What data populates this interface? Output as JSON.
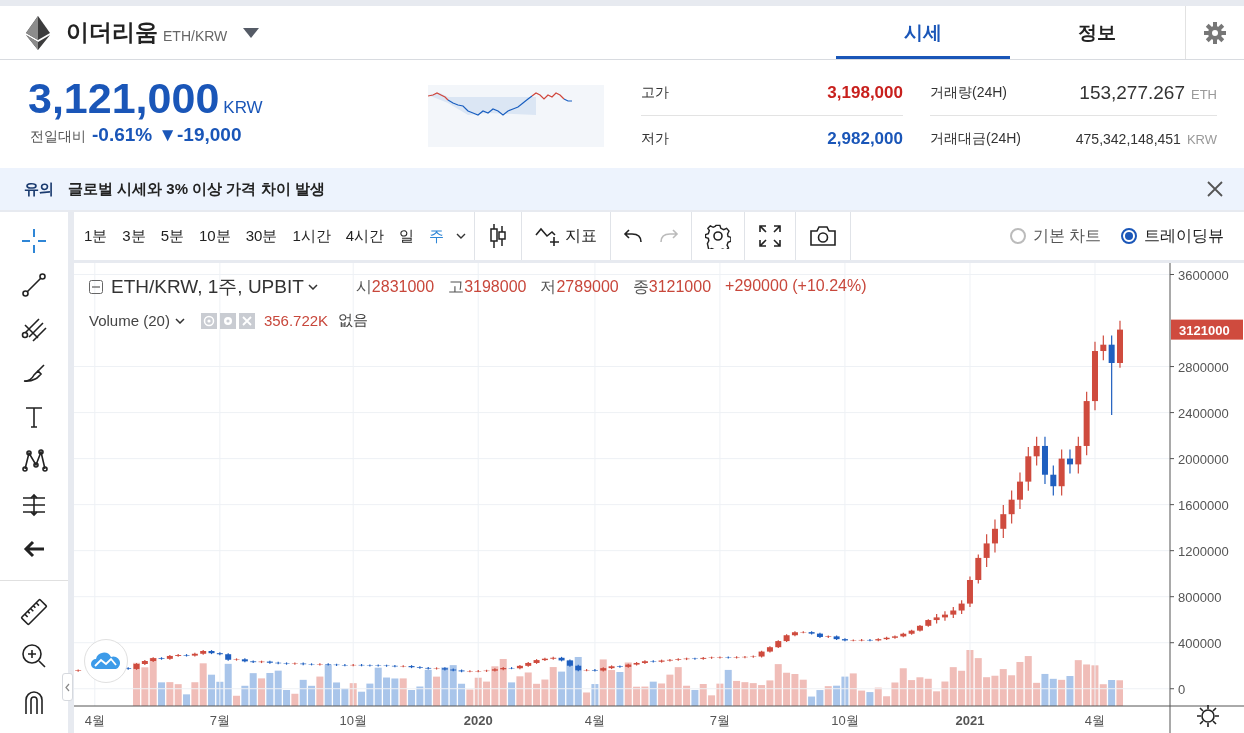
{
  "header": {
    "coin_name": "이더리움",
    "pair": "ETH/KRW"
  },
  "tabs": [
    {
      "label": "시세",
      "selected": true
    },
    {
      "label": "정보",
      "selected": false
    }
  ],
  "price": {
    "value": "3,121,000",
    "unit": "KRW",
    "change_label": "전일대비",
    "change_rate": "-0.61%",
    "change_amount": "▼-19,000",
    "color": "#1a56b8"
  },
  "stats": [
    {
      "label": "고가",
      "value": "3,198,000",
      "color": "#c8201d"
    },
    {
      "label": "저가",
      "value": "2,982,000",
      "color": "#1a56b8"
    }
  ],
  "volume_stats": [
    {
      "label": "거래량(24H)",
      "value": "153,277.267",
      "unit": "ETH",
      "kind": "large"
    },
    {
      "label": "거래대금(24H)",
      "value": "475,342,148,451",
      "unit": "KRW",
      "kind": "small"
    }
  ],
  "notice": {
    "tag": "유의",
    "message": "글로벌 시세와 3% 이상 가격 차이 발생"
  },
  "intervals": [
    {
      "label": "1분",
      "selected": false
    },
    {
      "label": "3분",
      "selected": false
    },
    {
      "label": "5분",
      "selected": false
    },
    {
      "label": "10분",
      "selected": false
    },
    {
      "label": "30분",
      "selected": false
    },
    {
      "label": "1시간",
      "selected": false
    },
    {
      "label": "4시간",
      "selected": false
    },
    {
      "label": "일",
      "selected": false
    },
    {
      "label": "주",
      "selected": true
    }
  ],
  "indicator_label": "지표",
  "chart_modes": [
    {
      "label": "기본 차트",
      "selected": false
    },
    {
      "label": "트레이딩뷰",
      "selected": true
    }
  ],
  "legend": {
    "symbol": "ETH/KRW, 1주, UPBIT",
    "ohlc": [
      {
        "label": "시",
        "value": "2831000"
      },
      {
        "label": "고",
        "value": "3198000"
      },
      {
        "label": "저",
        "value": "2789000"
      },
      {
        "label": "종",
        "value": "3121000"
      }
    ],
    "change": "+290000 (+10.24%)"
  },
  "volume_legend": {
    "name": "Volume (20)",
    "value": "356.722K",
    "extra": "없음"
  },
  "chart": {
    "price_tag": "3121000",
    "tick_styles": [
      {
        "bold": false
      },
      {
        "bold": false
      },
      {
        "bold": false
      },
      {
        "bold": true
      },
      {
        "bold": false
      },
      {
        "bold": false
      },
      {
        "bold": false
      },
      {
        "bold": true
      },
      {
        "bold": false
      }
    ],
    "chart_data": {
      "type": "candlestick",
      "grid": true,
      "ylim": [
        -150000,
        3700000
      ],
      "categories": [
        null,
        null,
        "4월",
        null,
        null,
        null,
        null,
        null,
        null,
        null,
        null,
        null,
        null,
        null,
        null,
        null,
        null,
        "7월",
        null,
        null,
        null,
        null,
        null,
        null,
        null,
        null,
        null,
        null,
        null,
        null,
        null,
        null,
        null,
        "10월",
        null,
        null,
        null,
        null,
        null,
        null,
        null,
        null,
        null,
        null,
        null,
        null,
        null,
        null,
        "2020",
        null,
        null,
        null,
        null,
        null,
        null,
        null,
        null,
        null,
        null,
        null,
        null,
        null,
        "4월",
        null,
        null,
        null,
        null,
        null,
        null,
        null,
        null,
        null,
        null,
        null,
        null,
        null,
        null,
        "7월",
        null,
        null,
        null,
        null,
        null,
        null,
        null,
        null,
        null,
        null,
        null,
        null,
        null,
        null,
        "10월",
        null,
        null,
        null,
        null,
        null,
        null,
        null,
        null,
        null,
        null,
        null,
        null,
        null,
        null,
        "2021",
        null,
        null,
        null,
        null,
        null,
        null,
        null,
        null,
        null,
        null,
        null,
        null,
        null,
        null,
        "4월",
        null,
        null,
        null
      ],
      "yticks": [
        {
          "value": 3600000,
          "label": "3600000"
        },
        {
          "value": 2800000,
          "label": "2800000"
        },
        {
          "value": 2400000,
          "label": "2400000"
        },
        {
          "value": 2000000,
          "label": "2000000"
        },
        {
          "value": 1600000,
          "label": "1600000"
        },
        {
          "value": 1200000,
          "label": "1200000"
        },
        {
          "value": 800000,
          "label": "800000"
        },
        {
          "value": 400000,
          "label": "400000"
        },
        {
          "value": 0,
          "label": "0"
        }
      ],
      "ohlc": [
        [
          155000,
          168000,
          147000,
          160000
        ],
        null,
        null,
        null,
        null,
        null,
        [
          178000,
          186000,
          164000,
          172000
        ],
        [
          172000,
          223000,
          164000,
          215000
        ],
        [
          215000,
          249000,
          207000,
          241000
        ],
        [
          241000,
          274000,
          233000,
          266000
        ],
        [
          266000,
          274000,
          252000,
          260000
        ],
        [
          260000,
          293000,
          252000,
          285000
        ],
        [
          285000,
          301000,
          277000,
          293000
        ],
        [
          293000,
          301000,
          280000,
          288000
        ],
        [
          288000,
          312000,
          280000,
          304000
        ],
        [
          304000,
          336000,
          296000,
          328000
        ],
        [
          328000,
          336000,
          301000,
          309000
        ],
        [
          309000,
          317000,
          292000,
          300000
        ],
        [
          300000,
          308000,
          244000,
          252000
        ],
        [
          252000,
          264000,
          244000,
          256000
        ],
        [
          256000,
          264000,
          230000,
          238000
        ],
        [
          238000,
          246000,
          223000,
          231000
        ],
        [
          231000,
          244000,
          223000,
          236000
        ],
        [
          236000,
          244000,
          218000,
          226000
        ],
        [
          226000,
          234000,
          213000,
          221000
        ],
        [
          221000,
          229000,
          209000,
          217000
        ],
        [
          217000,
          227000,
          209000,
          219000
        ],
        [
          219000,
          227000,
          205000,
          213000
        ],
        [
          213000,
          221000,
          203000,
          211000
        ],
        [
          211000,
          222000,
          203000,
          214000
        ],
        [
          214000,
          222000,
          201000,
          209000
        ],
        [
          209000,
          217000,
          198000,
          206000
        ],
        [
          206000,
          214000,
          196000,
          204000
        ],
        [
          204000,
          215000,
          196000,
          207000
        ],
        [
          207000,
          215000,
          195000,
          203000
        ],
        [
          203000,
          211000,
          194000,
          202000
        ],
        [
          202000,
          210000,
          193000,
          201000
        ],
        [
          201000,
          209000,
          191000,
          199000
        ],
        [
          199000,
          207000,
          186000,
          194000
        ],
        [
          194000,
          205000,
          186000,
          197000
        ],
        [
          197000,
          205000,
          179000,
          187000
        ],
        [
          187000,
          195000,
          173000,
          181000
        ],
        [
          181000,
          189000,
          167000,
          175000
        ],
        [
          175000,
          186000,
          167000,
          178000
        ],
        [
          178000,
          186000,
          159000,
          167000
        ],
        [
          167000,
          175000,
          151000,
          159000
        ],
        [
          159000,
          167000,
          143000,
          151000
        ],
        [
          151000,
          160000,
          143000,
          152000
        ],
        [
          152000,
          162000,
          144000,
          154000
        ],
        [
          154000,
          165000,
          146000,
          157000
        ],
        [
          157000,
          177000,
          149000,
          169000
        ],
        [
          169000,
          188000,
          161000,
          180000
        ],
        [
          180000,
          188000,
          170000,
          178000
        ],
        [
          178000,
          207000,
          170000,
          199000
        ],
        [
          199000,
          232000,
          191000,
          224000
        ],
        [
          224000,
          257000,
          216000,
          249000
        ],
        [
          249000,
          269000,
          241000,
          261000
        ],
        [
          261000,
          277000,
          253000,
          269000
        ],
        [
          269000,
          277000,
          238000,
          246000
        ],
        [
          246000,
          254000,
          192000,
          200000
        ],
        [
          200000,
          208000,
          152000,
          160000
        ],
        [
          160000,
          171000,
          152000,
          163000
        ],
        [
          163000,
          171000,
          150000,
          158000
        ],
        [
          158000,
          187000,
          150000,
          179000
        ],
        [
          179000,
          203000,
          171000,
          195000
        ],
        [
          195000,
          203000,
          182000,
          190000
        ],
        [
          190000,
          218000,
          182000,
          210000
        ],
        [
          210000,
          232000,
          202000,
          224000
        ],
        [
          224000,
          247000,
          216000,
          239000
        ],
        [
          239000,
          247000,
          227000,
          235000
        ],
        [
          235000,
          253000,
          227000,
          245000
        ],
        [
          245000,
          259000,
          237000,
          251000
        ],
        [
          251000,
          265000,
          243000,
          257000
        ],
        [
          257000,
          270000,
          249000,
          262000
        ],
        [
          262000,
          270000,
          252000,
          260000
        ],
        [
          260000,
          276000,
          252000,
          268000
        ],
        [
          268000,
          279000,
          260000,
          271000
        ],
        [
          271000,
          280000,
          263000,
          272000
        ],
        [
          272000,
          280000,
          262000,
          270000
        ],
        [
          270000,
          282000,
          262000,
          274000
        ],
        [
          274000,
          285000,
          266000,
          277000
        ],
        [
          277000,
          288000,
          269000,
          280000
        ],
        [
          280000,
          331000,
          272000,
          323000
        ],
        [
          323000,
          369000,
          315000,
          361000
        ],
        [
          361000,
          422000,
          353000,
          414000
        ],
        [
          414000,
          473000,
          406000,
          465000
        ],
        [
          465000,
          499000,
          457000,
          491000
        ],
        [
          491000,
          500000,
          483000,
          492000
        ],
        [
          492000,
          500000,
          471000,
          479000
        ],
        [
          479000,
          487000,
          442000,
          450000
        ],
        [
          450000,
          463000,
          442000,
          455000
        ],
        [
          455000,
          463000,
          423000,
          431000
        ],
        [
          431000,
          439000,
          412000,
          420000
        ],
        [
          420000,
          428000,
          412000,
          420000
        ],
        [
          420000,
          432000,
          412000,
          424000
        ],
        [
          424000,
          432000,
          412000,
          420000
        ],
        [
          420000,
          439000,
          412000,
          431000
        ],
        [
          431000,
          451000,
          423000,
          443000
        ],
        [
          443000,
          463000,
          435000,
          455000
        ],
        [
          455000,
          486000,
          447000,
          478000
        ],
        [
          478000,
          513000,
          470000,
          505000
        ],
        [
          505000,
          555000,
          497000,
          547000
        ],
        [
          547000,
          605000,
          539000,
          597000
        ],
        [
          597000,
          650000,
          567000,
          620000
        ],
        [
          620000,
          674000,
          590000,
          644000
        ],
        [
          644000,
          710000,
          614000,
          680000
        ],
        [
          680000,
          770000,
          650000,
          740000
        ],
        [
          740000,
          975000,
          710000,
          945000
        ],
        [
          945000,
          1167000,
          915000,
          1137000
        ],
        [
          1137000,
          1343000,
          1057000,
          1263000
        ],
        [
          1263000,
          1470000,
          1183000,
          1390000
        ],
        [
          1390000,
          1597000,
          1310000,
          1517000
        ],
        [
          1517000,
          1723000,
          1437000,
          1643000
        ],
        [
          1643000,
          1880000,
          1563000,
          1800000
        ],
        [
          1800000,
          2100000,
          1720000,
          2020000
        ],
        [
          2020000,
          2190000,
          1940000,
          2110000
        ],
        [
          2110000,
          2190000,
          1780000,
          1860000
        ],
        [
          1860000,
          1940000,
          1680000,
          1760000
        ],
        [
          1760000,
          2080000,
          1680000,
          2000000
        ],
        [
          2000000,
          2080000,
          1870000,
          1950000
        ],
        [
          1950000,
          2190000,
          1870000,
          2110000
        ],
        [
          2110000,
          2580000,
          2030000,
          2500000
        ],
        [
          2500000,
          3015000,
          2420000,
          2935000
        ],
        [
          2935000,
          3070000,
          2855000,
          2990000
        ],
        [
          2990000,
          3070000,
          2380000,
          2831000
        ],
        [
          2831000,
          3198000,
          2789000,
          3121000
        ]
      ]
    }
  }
}
